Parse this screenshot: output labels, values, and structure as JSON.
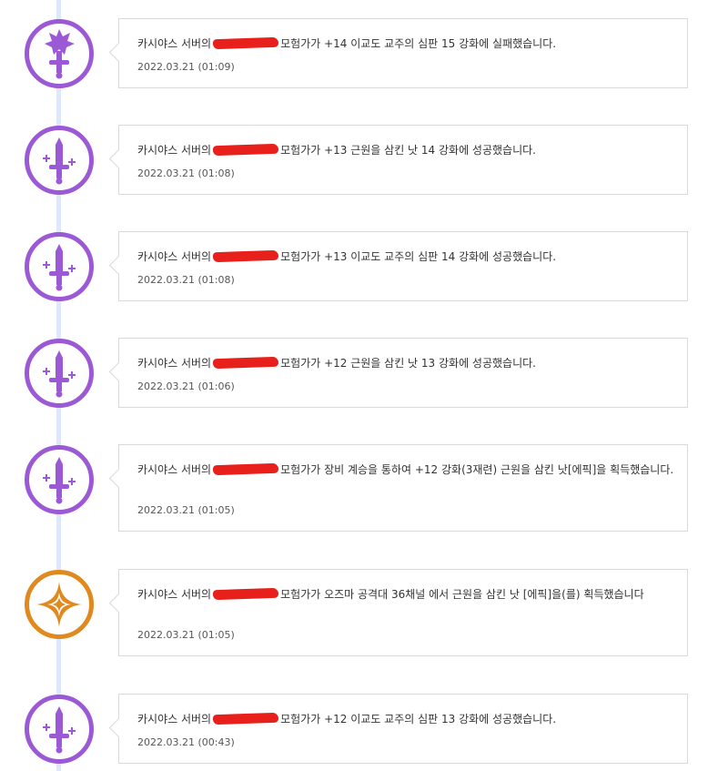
{
  "entries": [
    {
      "type": "fail",
      "icon": "sword-broken-icon",
      "text_pre": "카시야스 서버의",
      "text_post": "모험가가 +14 이교도 교주의 심판 15 강화에 실패했습니다.",
      "date": "2022.03.21 (01:09)"
    },
    {
      "type": "success",
      "icon": "sword-upgrade-icon",
      "text_pre": "카시야스 서버의",
      "text_post": "모험가가 +13 근원을 삼킨 낫 14 강화에 성공했습니다.",
      "date": "2022.03.21 (01:08)"
    },
    {
      "type": "success",
      "icon": "sword-upgrade-icon",
      "text_pre": "카시야스 서버의",
      "text_post": "모험가가 +13 이교도 교주의 심판 14 강화에 성공했습니다.",
      "date": "2022.03.21 (01:08)"
    },
    {
      "type": "success",
      "icon": "sword-upgrade-icon",
      "text_pre": "카시야스 서버의",
      "text_post": "모험가가 +12 근원을 삼킨 낫 13 강화에 성공했습니다.",
      "date": "2022.03.21 (01:06)"
    },
    {
      "type": "success",
      "icon": "sword-upgrade-icon",
      "text_pre": "카시야스 서버의",
      "text_post": "모험가가 장비 계승을 통하여 +12 강화(3재련) 근원을 삼킨 낫[에픽]을 획득했습니다.",
      "date": "2022.03.21 (01:05)"
    },
    {
      "type": "acquire",
      "icon": "star-sparkle-icon",
      "text_pre": "카시야스 서버의",
      "text_post": "모험가가 오즈마 공격대 36채널 에서 근원을 삼킨 낫 [에픽]을(를) 획득했습니다",
      "date": "2022.03.21 (01:05)"
    },
    {
      "type": "success",
      "icon": "sword-upgrade-icon",
      "text_pre": "카시야스 서버의",
      "text_post": "모험가가 +12 이교도 교주의 심판 13 강화에 성공했습니다.",
      "date": "2022.03.21 (00:43)"
    }
  ],
  "colors": {
    "purple": "#9b59d6",
    "orange": "#e0891e",
    "redaction": "#e8201c",
    "timeline": "#dfe7fb"
  }
}
